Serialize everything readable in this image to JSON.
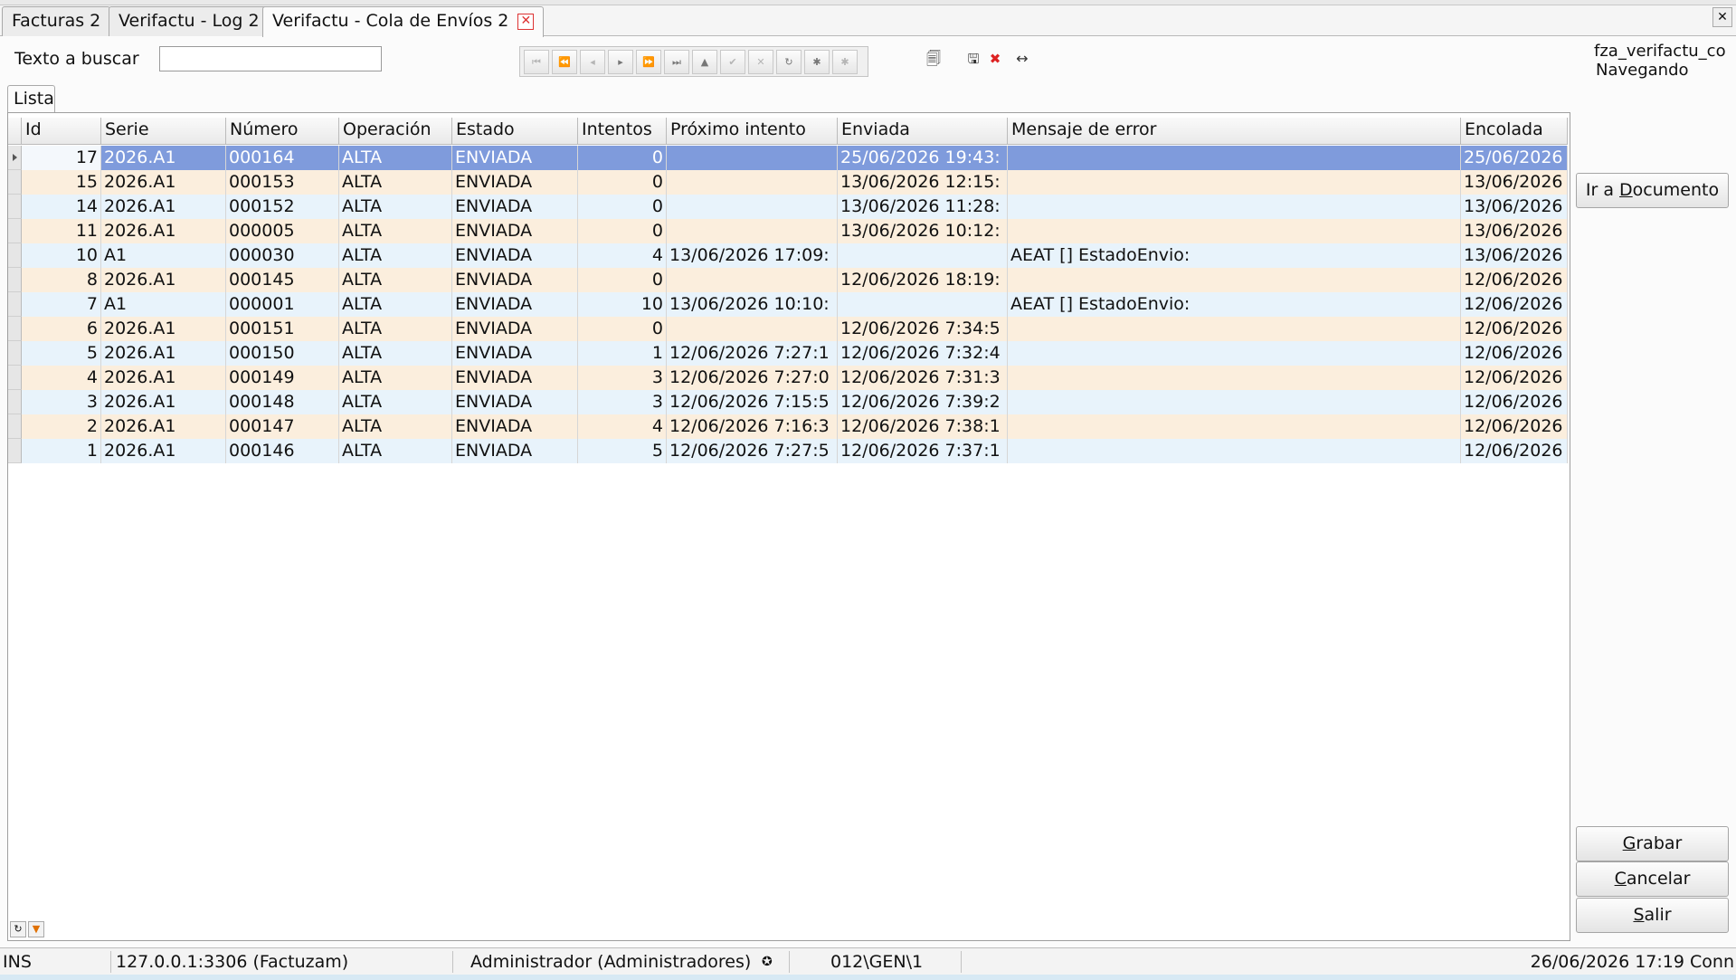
{
  "tabs": [
    {
      "label": "Facturas 2"
    },
    {
      "label": "Verifactu - Log 2"
    },
    {
      "label": "Verifactu - Cola de Envíos 2"
    }
  ],
  "search": {
    "label": "Texto a buscar",
    "value": ""
  },
  "status_top": {
    "context": "fza_verifactu_co",
    "mode": "Navegando"
  },
  "inner_tab": {
    "label": "Lista"
  },
  "grid": {
    "columns": [
      "Id",
      "Serie",
      "Número",
      "Operación",
      "Estado",
      "Intentos",
      "Próximo intento",
      "Enviada",
      "Mensaje de error",
      "Encolada"
    ],
    "rows": [
      {
        "id": "17",
        "serie": "2026.A1",
        "numero": "000164",
        "operacion": "ALTA",
        "estado": "ENVIADA",
        "intentos": "0",
        "proximo": "",
        "enviada": "25/06/2026 19:43:",
        "mensaje": "",
        "encolada": "25/06/2026"
      },
      {
        "id": "15",
        "serie": "2026.A1",
        "numero": "000153",
        "operacion": "ALTA",
        "estado": "ENVIADA",
        "intentos": "0",
        "proximo": "",
        "enviada": "13/06/2026 12:15:",
        "mensaje": "",
        "encolada": "13/06/2026"
      },
      {
        "id": "14",
        "serie": "2026.A1",
        "numero": "000152",
        "operacion": "ALTA",
        "estado": "ENVIADA",
        "intentos": "0",
        "proximo": "",
        "enviada": "13/06/2026 11:28:",
        "mensaje": "",
        "encolada": "13/06/2026"
      },
      {
        "id": "11",
        "serie": "2026.A1",
        "numero": "000005",
        "operacion": "ALTA",
        "estado": "ENVIADA",
        "intentos": "0",
        "proximo": "",
        "enviada": "13/06/2026 10:12:",
        "mensaje": "",
        "encolada": "13/06/2026"
      },
      {
        "id": "10",
        "serie": "A1",
        "numero": "000030",
        "operacion": "ALTA",
        "estado": "ENVIADA",
        "intentos": "4",
        "proximo": "13/06/2026 17:09:",
        "enviada": "",
        "mensaje": "AEAT [] EstadoEnvio:",
        "encolada": "13/06/2026"
      },
      {
        "id": "8",
        "serie": "2026.A1",
        "numero": "000145",
        "operacion": "ALTA",
        "estado": "ENVIADA",
        "intentos": "0",
        "proximo": "",
        "enviada": "12/06/2026 18:19:",
        "mensaje": "",
        "encolada": "12/06/2026"
      },
      {
        "id": "7",
        "serie": "A1",
        "numero": "000001",
        "operacion": "ALTA",
        "estado": "ENVIADA",
        "intentos": "10",
        "proximo": "13/06/2026 10:10:",
        "enviada": "",
        "mensaje": "AEAT [] EstadoEnvio:",
        "encolada": "12/06/2026"
      },
      {
        "id": "6",
        "serie": "2026.A1",
        "numero": "000151",
        "operacion": "ALTA",
        "estado": "ENVIADA",
        "intentos": "0",
        "proximo": "",
        "enviada": "12/06/2026 7:34:5",
        "mensaje": "",
        "encolada": "12/06/2026"
      },
      {
        "id": "5",
        "serie": "2026.A1",
        "numero": "000150",
        "operacion": "ALTA",
        "estado": "ENVIADA",
        "intentos": "1",
        "proximo": "12/06/2026 7:27:1",
        "enviada": "12/06/2026 7:32:4",
        "mensaje": "",
        "encolada": "12/06/2026"
      },
      {
        "id": "4",
        "serie": "2026.A1",
        "numero": "000149",
        "operacion": "ALTA",
        "estado": "ENVIADA",
        "intentos": "3",
        "proximo": "12/06/2026 7:27:0",
        "enviada": "12/06/2026 7:31:3",
        "mensaje": "",
        "encolada": "12/06/2026"
      },
      {
        "id": "3",
        "serie": "2026.A1",
        "numero": "000148",
        "operacion": "ALTA",
        "estado": "ENVIADA",
        "intentos": "3",
        "proximo": "12/06/2026 7:15:5",
        "enviada": "12/06/2026 7:39:2",
        "mensaje": "",
        "encolada": "12/06/2026"
      },
      {
        "id": "2",
        "serie": "2026.A1",
        "numero": "000147",
        "operacion": "ALTA",
        "estado": "ENVIADA",
        "intentos": "4",
        "proximo": "12/06/2026 7:16:3",
        "enviada": "12/06/2026 7:38:1",
        "mensaje": "",
        "encolada": "12/06/2026"
      },
      {
        "id": "1",
        "serie": "2026.A1",
        "numero": "000146",
        "operacion": "ALTA",
        "estado": "ENVIADA",
        "intentos": "5",
        "proximo": "12/06/2026 7:27:5",
        "enviada": "12/06/2026 7:37:1",
        "mensaje": "",
        "encolada": "12/06/2026"
      }
    ]
  },
  "buttons": {
    "ir_documento": {
      "pre": "Ir a ",
      "key": "D",
      "post": "ocumento"
    },
    "grabar": {
      "pre": "",
      "key": "G",
      "post": "rabar"
    },
    "cancelar": {
      "pre": "",
      "key": "C",
      "post": "ancelar"
    },
    "salir": {
      "pre": "",
      "key": "S",
      "post": "alir"
    }
  },
  "statusbar": {
    "mode": "INS",
    "connection": "127.0.0.1:3306 (Factuzam)",
    "user": "Administrador (Administradores)",
    "path": "012\\GEN\\1",
    "datetime": "26/06/2026 17:19 Conn"
  },
  "colors": {
    "selected_row": "#7f9bdc",
    "odd_row": "#e8f3fb",
    "even_row": "#fbeedd"
  }
}
